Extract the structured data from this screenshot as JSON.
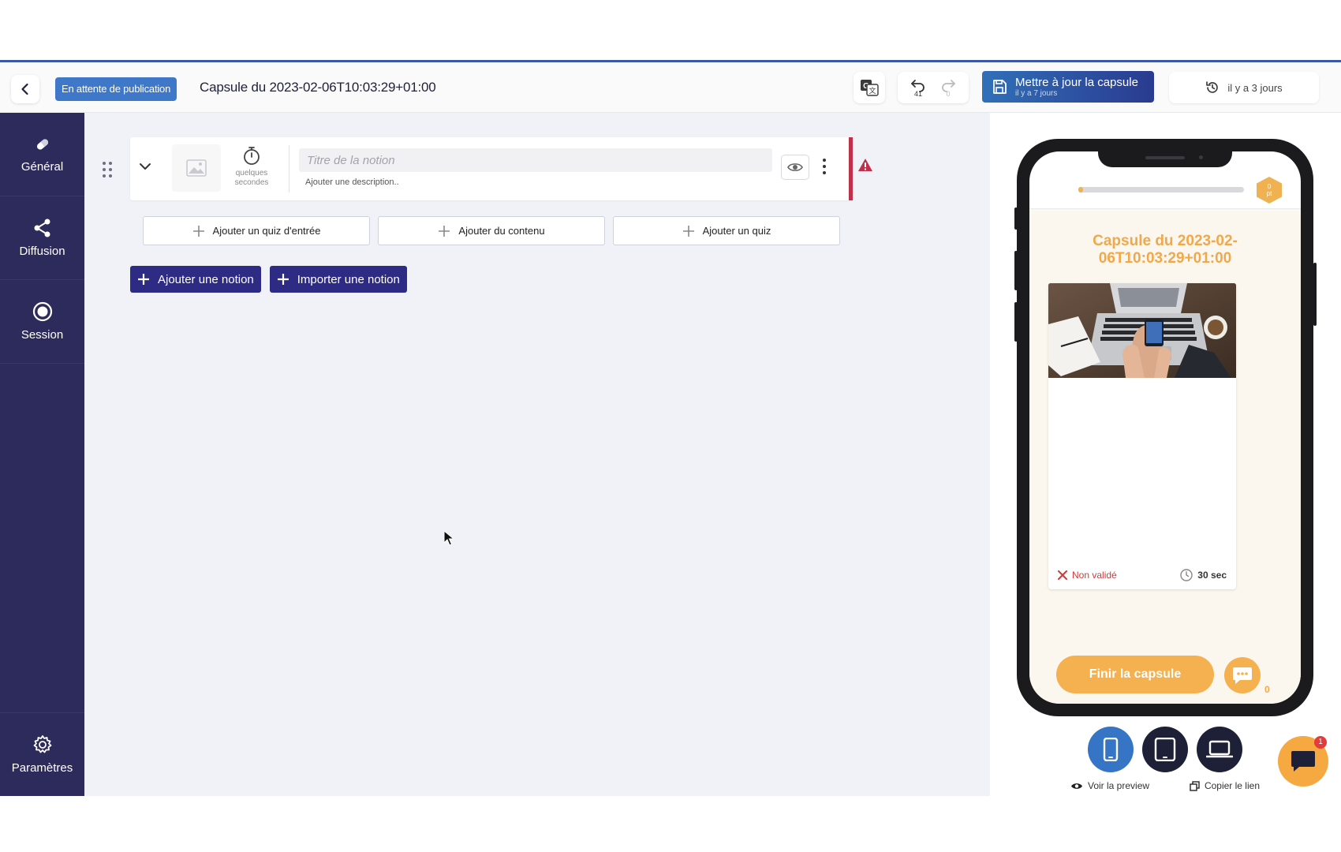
{
  "header": {
    "status": "En attente de publication",
    "title": "Capsule du 2023-02-06T10:03:29+01:00",
    "undo_count": "41",
    "redo_count": "0",
    "save_label": "Mettre à jour la capsule",
    "save_sub": "il y a 7 jours",
    "history_label": "il y a 3 jours"
  },
  "sidebar": {
    "items": [
      {
        "label": "Général",
        "icon": "pill-icon"
      },
      {
        "label": "Diffusion",
        "icon": "share-icon"
      },
      {
        "label": "Session",
        "icon": "radio-icon"
      }
    ],
    "settings_label": "Paramètres"
  },
  "notion": {
    "timer_label": "quelques secondes",
    "title_placeholder": "Titre de la notion",
    "description": "Ajouter une description.."
  },
  "actions": {
    "add_entry_quiz": "Ajouter un quiz d'entrée",
    "add_content": "Ajouter du contenu",
    "add_quiz": "Ajouter un quiz",
    "add_notion": "Ajouter une notion",
    "import_notion": "Importer une notion"
  },
  "preview": {
    "progress": 0.03,
    "points_value": "0",
    "points_unit": "pt",
    "capsule_title": "Capsule du 2023-02-06T10:03:29+01:00",
    "status": "Non validé",
    "duration": "30 sec",
    "finish_label": "Finir la capsule",
    "comments_count": "0",
    "view_preview": "Voir la preview",
    "copy_link": "Copier le lien",
    "help_badge": "1"
  },
  "colors": {
    "sidebar_bg": "#2d2b5c",
    "primary": "#2e2b85",
    "status_badge": "#3f78c8",
    "accent_orange": "#f5b04f",
    "warning_red": "#c0304a"
  }
}
